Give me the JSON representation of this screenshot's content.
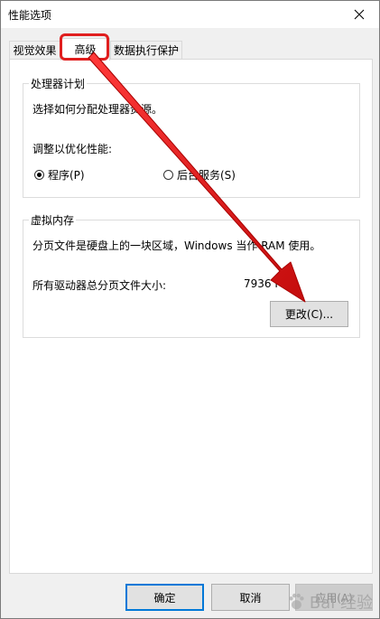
{
  "window": {
    "title": "性能选项"
  },
  "tabs": [
    {
      "label": "视觉效果"
    },
    {
      "label": "高级"
    },
    {
      "label": "数据执行保护"
    }
  ],
  "processor": {
    "legend": "处理器计划",
    "description": "选择如何分配处理器资源。",
    "optimize_label": "调整以优化性能:",
    "options": [
      {
        "label": "程序(P)",
        "checked": true
      },
      {
        "label": "后台服务(S)",
        "checked": false
      }
    ]
  },
  "virtual_memory": {
    "legend": "虚拟内存",
    "description": "分页文件是硬盘上的一块区域，Windows 当作 RAM 使用。",
    "total_label": "所有驱动器总分页文件大小:",
    "total_value": "7936 MB",
    "change_button": "更改(C)..."
  },
  "footer": {
    "ok": "确定",
    "cancel": "取消",
    "apply": "应用(A)"
  },
  "watermark": {
    "text": "Bai 经验"
  },
  "colors": {
    "annotation": "#e01e1e",
    "accent": "#0078d7"
  }
}
